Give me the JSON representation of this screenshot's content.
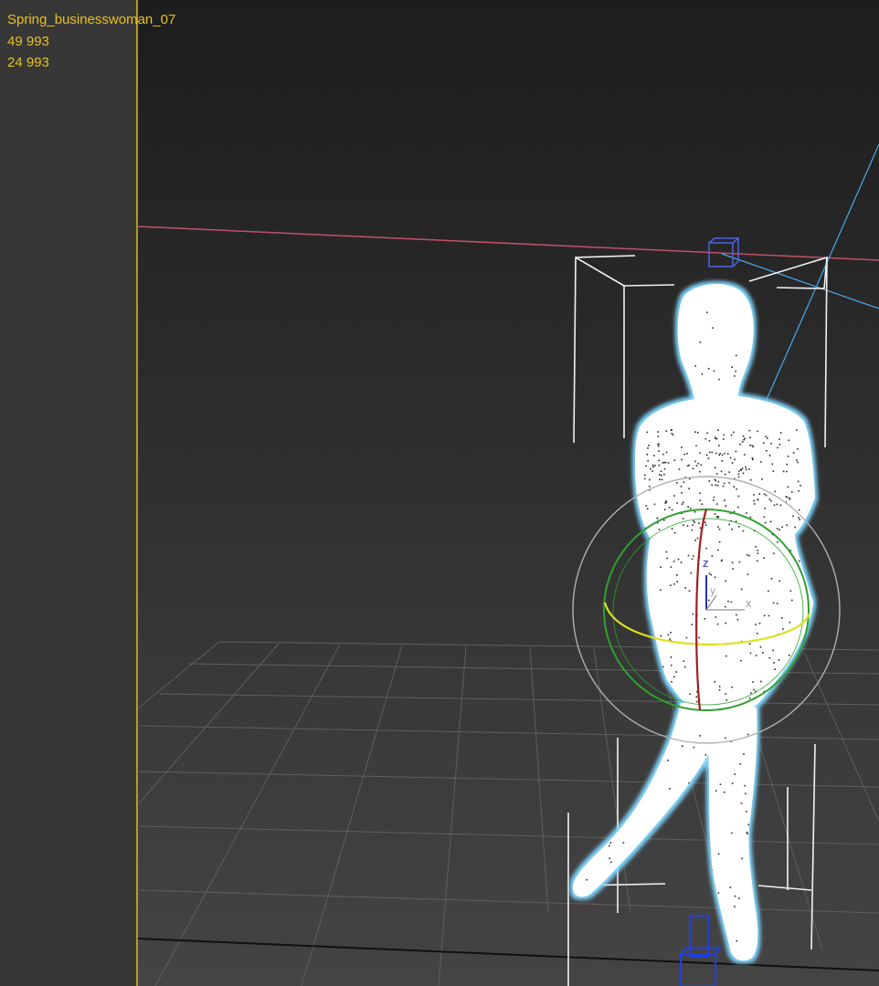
{
  "viewport": {
    "object_name": "Spring_businesswoman_07",
    "polygon_count": "49 993",
    "vertex_count": "24 993",
    "gizmo_axes": {
      "z": "z",
      "y": "y",
      "x": "x"
    },
    "colors": {
      "stats_text": "#e8c020",
      "selection_outline": "#7fd6ff",
      "x_axis_line": "#c0506a",
      "y_axis_line": "#d8c020",
      "view_ray": "#4aa8e8",
      "grid": "#5e5e5e",
      "gizmo_ring_outer": "#b0b0b0",
      "gizmo_ring_green": "#30a030",
      "gizmo_ring_yellow": "#e0e020",
      "gizmo_ring_red": "#a02020",
      "helper_blue": "#3050e0"
    }
  }
}
